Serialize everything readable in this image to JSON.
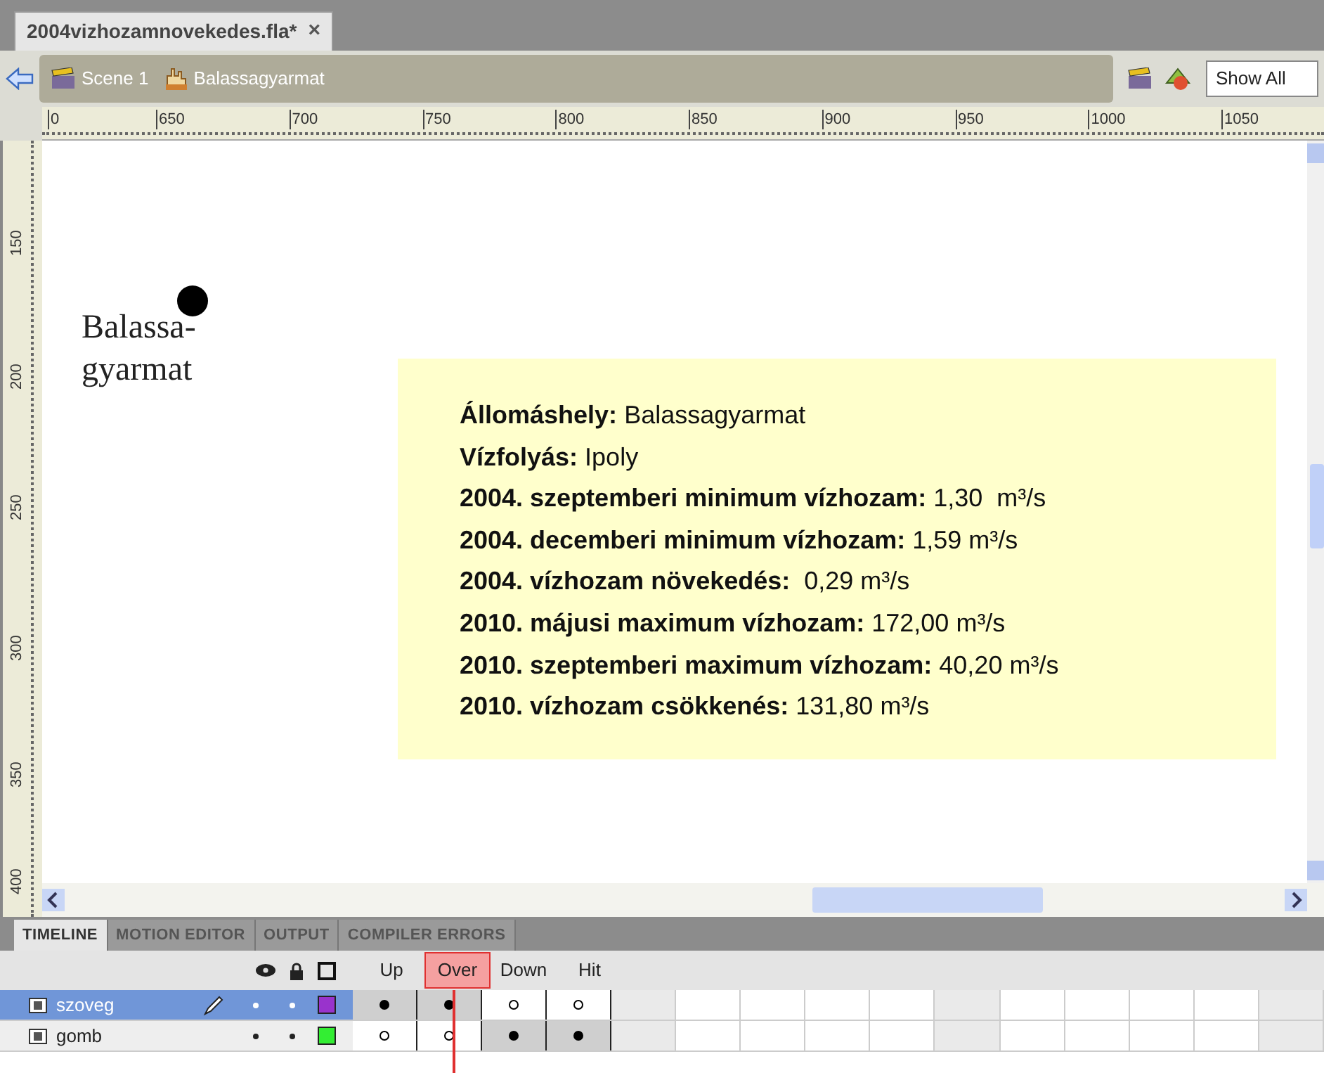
{
  "document_tab": {
    "title": "2004vizhozamnovekedes.fla*",
    "close": "×"
  },
  "breadcrumbs": [
    "Scene 1",
    "Balassagyarmat"
  ],
  "zoom_select": {
    "value": "Show All"
  },
  "ruler": {
    "h_labels": [
      "0",
      "650",
      "700",
      "750",
      "800",
      "850",
      "900",
      "950",
      "1000",
      "1050"
    ],
    "v_labels": [
      "150",
      "200",
      "250",
      "300",
      "350",
      "400"
    ]
  },
  "stage": {
    "marker_label": [
      "Balassa-",
      "gyarmat"
    ],
    "info_lines": [
      {
        "label": "Állomáshely:",
        "value": "Balassagyarmat"
      },
      {
        "label": "Vízfolyás:",
        "value": "Ipoly"
      },
      {
        "label": "2004. szeptemberi minimum vízhozam:",
        "value": "1,30  m³/s"
      },
      {
        "label": "2004. decemberi minimum vízhozam:",
        "value": "1,59 m³/s"
      },
      {
        "label": "2004. vízhozam növekedés:",
        "value": " 0,29 m³/s"
      },
      {
        "label": "2010. májusi maximum vízhozam:",
        "value": "172,00 m³/s"
      },
      {
        "label": "2010. szeptemberi maximum vízhozam:",
        "value": "40,20 m³/s"
      },
      {
        "label": "2010. vízhozam csökkenés:",
        "value": "131,80 m³/s"
      }
    ]
  },
  "timeline": {
    "tabs": [
      {
        "label": "TIMELINE",
        "selected": true
      },
      {
        "label": "MOTION EDITOR",
        "selected": false
      },
      {
        "label": "OUTPUT",
        "selected": false
      },
      {
        "label": "COMPILER ERRORS",
        "selected": false
      }
    ],
    "frame_labels": [
      {
        "label": "Up",
        "selected": false
      },
      {
        "label": "Over",
        "selected": true
      },
      {
        "label": "Down",
        "selected": false
      },
      {
        "label": "Hit",
        "selected": false
      }
    ],
    "layers": [
      {
        "name": "szoveg",
        "selected": true,
        "color": "#9933cc",
        "frames": [
          {
            "filled": true
          },
          {
            "filled": true
          },
          {
            "filled": false
          },
          {
            "filled": false
          }
        ]
      },
      {
        "name": "gomb",
        "selected": false,
        "color": "#33ee33",
        "frames": [
          {
            "filled": false
          },
          {
            "filled": false
          },
          {
            "filled": true
          },
          {
            "filled": true
          }
        ]
      }
    ]
  }
}
